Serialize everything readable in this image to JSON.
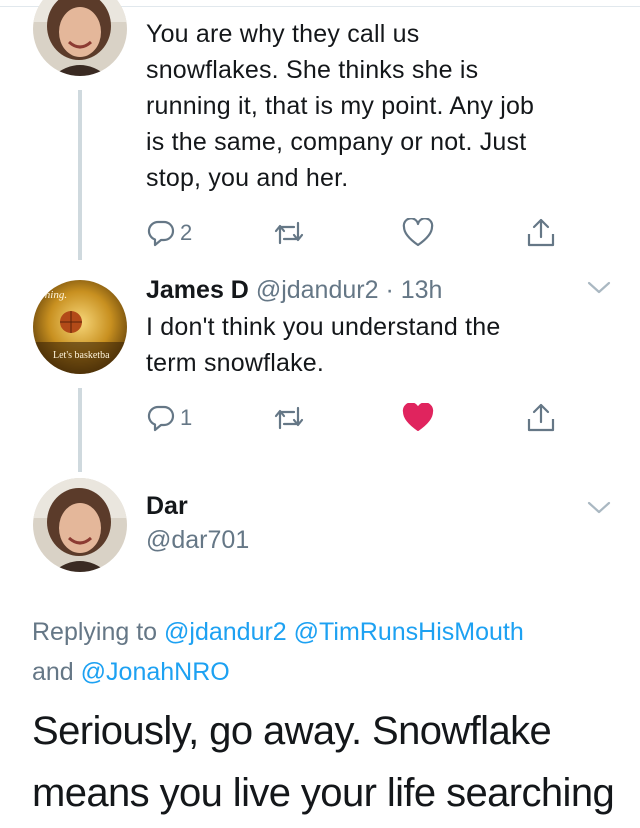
{
  "tweets": [
    {
      "text_lines": [
        "You are why they call us",
        "snowflakes. She thinks she is",
        "running it, that is my point. Any job",
        "is the same, company or not.  Just",
        "stop, you and her."
      ],
      "actions": {
        "reply_count": "2",
        "retweet_count": "",
        "like_count": "",
        "liked": false
      }
    },
    {
      "name": "James D",
      "handle": "@jdandur2",
      "dot": "·",
      "time": "13h",
      "avatar_text": {
        "top": "orning.",
        "bottom": "Let's basketba"
      },
      "text_lines": [
        "I don't think you understand the",
        "term snowflake."
      ],
      "actions": {
        "reply_count": "1",
        "retweet_count": "",
        "like_count": "",
        "liked": true
      }
    }
  ],
  "focused": {
    "name": "Dar",
    "handle": "@dar701",
    "replying_prefix": "Replying to",
    "mention_1": "@jdandur2",
    "mention_2": "@TimRunsHisMouth",
    "joiner": "and",
    "mention_3": "@JonahNRO",
    "text_lines": [
      "Seriously, go away. Snowflake",
      "means you live your life searching"
    ]
  },
  "colors": {
    "accent": "#1da1f2",
    "like": "#e0245e",
    "muted": "#657786",
    "thread": "#cfd9de"
  },
  "icons": [
    "reply-icon",
    "retweet-icon",
    "like-icon",
    "share-icon",
    "chevron-down-icon"
  ]
}
